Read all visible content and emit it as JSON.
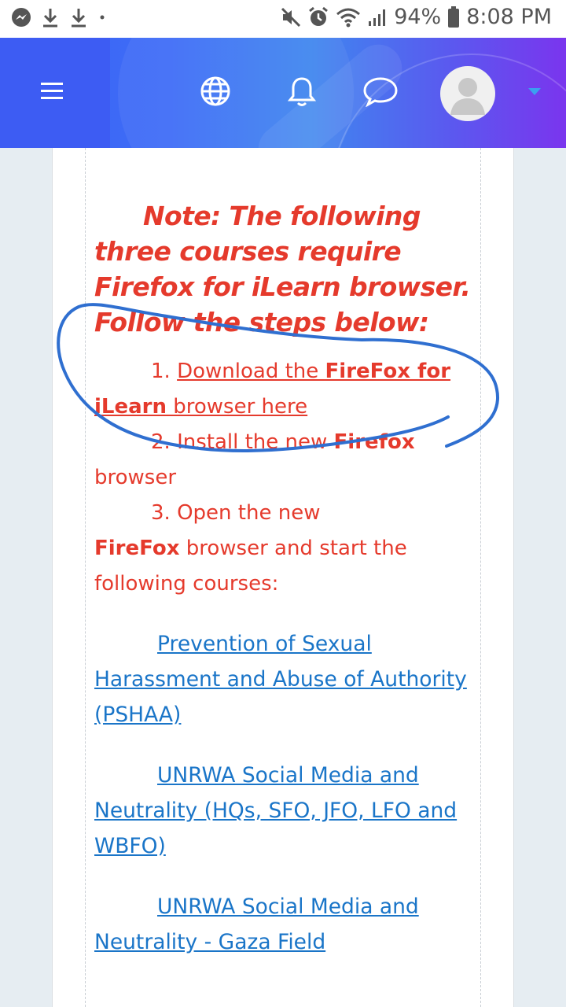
{
  "status_bar": {
    "battery": "94%",
    "time": "8:08 PM",
    "left_icons": [
      "messenger-icon",
      "download-icon",
      "download-icon",
      "dot-icon"
    ],
    "right_icons": [
      "mute-icon",
      "alarm-icon",
      "wifi-icon",
      "signal-icon",
      "battery-icon"
    ]
  },
  "header": {
    "icons": [
      "menu-icon",
      "globe-icon",
      "bell-icon",
      "chat-icon",
      "avatar-icon",
      "caret-down-icon"
    ],
    "accent_colors": [
      "#3a63f5",
      "#7a35ee"
    ]
  },
  "note": {
    "line1": "Note: The following three courses require Firefox for iLearn browser. Follow the steps below:"
  },
  "steps": {
    "step1_number": "1. ",
    "step1_link_pre": "Download the ",
    "step1_link_bold": "FireFox for iLearn",
    "step1_link_post": " browser here",
    "step2_pre": "2. Install the new ",
    "step2_bold": "Firefox",
    "step2_post": " browser",
    "step3_pre": "3. Open the new ",
    "step3_bold": "FireFox",
    "step3_post": " browser and start the following courses:"
  },
  "courses": [
    {
      "label": "Prevention of Sexual Harassment and Abuse of Authority (PSHAA)"
    },
    {
      "label": "UNRWA Social Media and Neutrality (HQs, SFO, JFO, LFO and WBFO)"
    },
    {
      "label": "UNRWA Social Media and Neutrality - Gaza Field"
    }
  ],
  "colors": {
    "note_red": "#e53a2c",
    "link_blue": "#1a75c8",
    "annotation_blue": "#2f6fd0"
  }
}
